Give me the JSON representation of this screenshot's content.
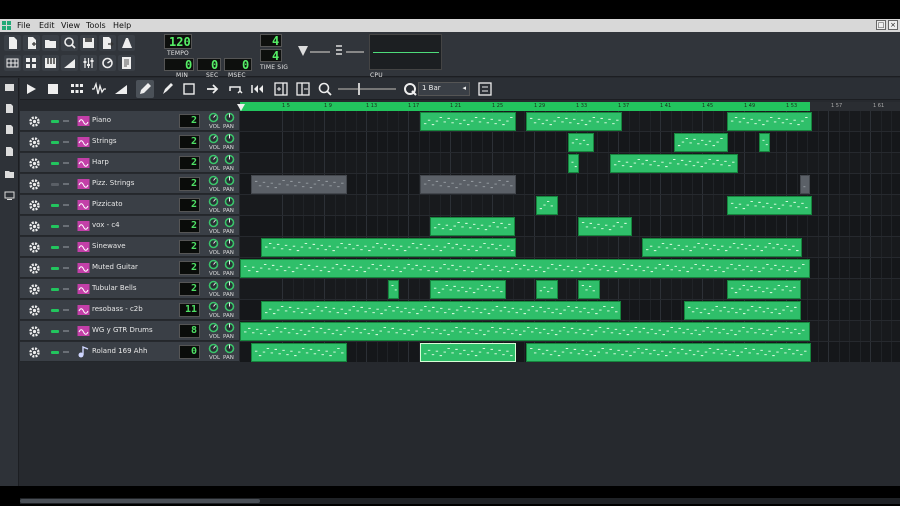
{
  "menu": [
    "File",
    "Edit",
    "View",
    "Tools",
    "Help"
  ],
  "window_buttons": [
    "□",
    "×"
  ],
  "transport": {
    "tempo": "120",
    "tempo_label": "TEMPO",
    "min": "0",
    "min_label": "MIN",
    "sec": "0",
    "sec_label": "SEC",
    "msec": "0",
    "msec_label": "MSEC",
    "timesig_top": "4",
    "timesig_bottom": "4",
    "timesig_label": "TIME SIG",
    "cpu_label": "CPU"
  },
  "song_editor": {
    "zoom_value": "1 Bar"
  },
  "ruler_ticks": [
    "1 5",
    "1 9",
    "1 13",
    "1 17",
    "1 21",
    "1 25",
    "1 29",
    "1 33",
    "1 37",
    "1 41",
    "1 45",
    "1 49",
    "1 53",
    "1 57",
    "1 61"
  ],
  "tracks": [
    {
      "name": "Piano",
      "channel": "2",
      "vol_label": "VOL",
      "pan_label": "PAN",
      "muted": false,
      "icon": "tripleoscillator-icon"
    },
    {
      "name": "Strings",
      "channel": "2",
      "vol_label": "VOL",
      "pan_label": "PAN",
      "muted": false,
      "icon": "tripleoscillator-icon"
    },
    {
      "name": "Harp",
      "channel": "2",
      "vol_label": "VOL",
      "pan_label": "PAN",
      "muted": false,
      "icon": "tripleoscillator-icon"
    },
    {
      "name": "Pizz. Strings",
      "channel": "2",
      "vol_label": "VOL",
      "pan_label": "PAN",
      "muted": true,
      "icon": "tripleoscillator-icon"
    },
    {
      "name": "Pizzicato",
      "channel": "2",
      "vol_label": "VOL",
      "pan_label": "PAN",
      "muted": false,
      "icon": "tripleoscillator-icon"
    },
    {
      "name": "vox - c4",
      "channel": "2",
      "vol_label": "VOL",
      "pan_label": "PAN",
      "muted": false,
      "icon": "tripleoscillator-icon"
    },
    {
      "name": "Sinewave",
      "channel": "2",
      "vol_label": "VOL",
      "pan_label": "PAN",
      "muted": false,
      "icon": "tripleoscillator-icon"
    },
    {
      "name": "Muted Guitar",
      "channel": "2",
      "vol_label": "VOL",
      "pan_label": "PAN",
      "muted": false,
      "icon": "tripleoscillator-icon"
    },
    {
      "name": "Tubular Bells",
      "channel": "2",
      "vol_label": "VOL",
      "pan_label": "PAN",
      "muted": false,
      "icon": "tripleoscillator-icon"
    },
    {
      "name": "resobass - c2b",
      "channel": "11",
      "vol_label": "VOL",
      "pan_label": "PAN",
      "muted": false,
      "icon": "tripleoscillator-icon"
    },
    {
      "name": "WG y GTR Drums",
      "channel": "8",
      "vol_label": "VOL",
      "pan_label": "PAN",
      "muted": false,
      "icon": "tripleoscillator-icon"
    },
    {
      "name": "Roland 169 Ahh",
      "channel": "0",
      "vol_label": "VOL",
      "pan_label": "PAN",
      "muted": false,
      "icon": "note-icon"
    }
  ],
  "colors": {
    "clip": "#2fbf6a",
    "clip_muted": "#5b6067",
    "lcd_green": "#55ee66",
    "loop_bar": "#22c55e",
    "background": "#26292e"
  }
}
